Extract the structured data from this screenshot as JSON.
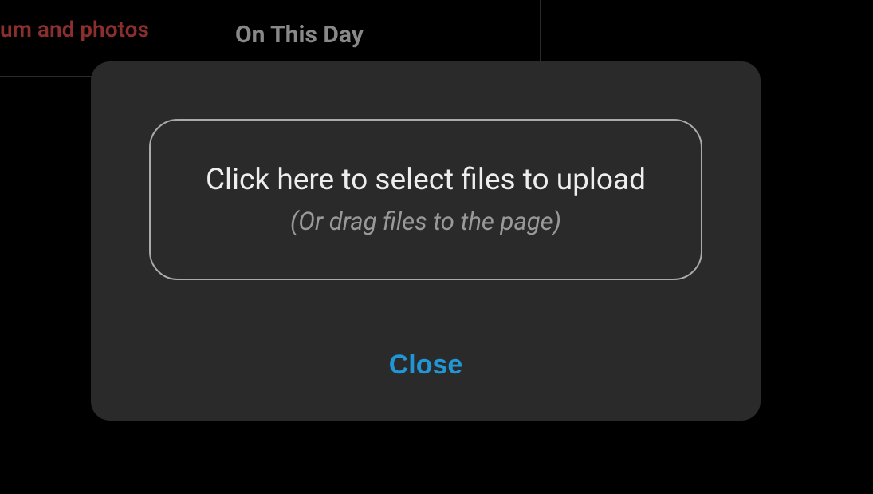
{
  "background": {
    "tab_label": "um and photos",
    "section_heading": "On This Day"
  },
  "modal": {
    "dropzone": {
      "main_text": "Click here to select files to upload",
      "sub_text": "(Or drag files to the page)"
    },
    "close_label": "Close"
  }
}
